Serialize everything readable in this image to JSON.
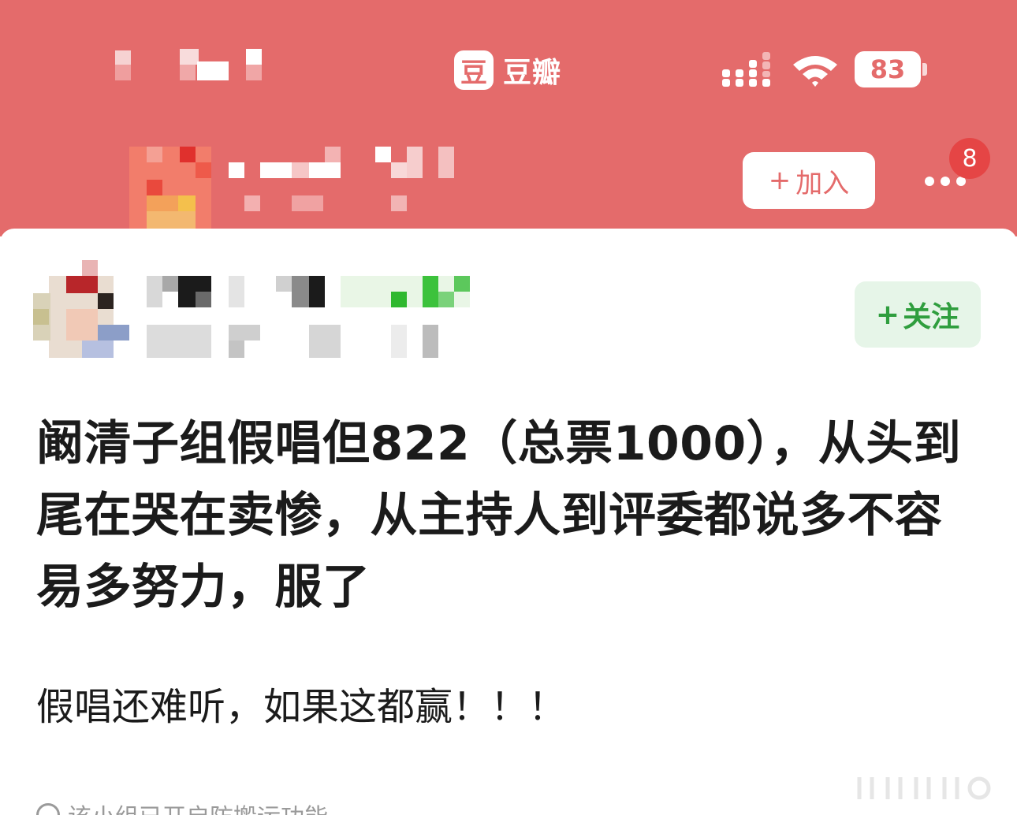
{
  "status_bar": {
    "app_logo_char": "豆",
    "app_name": "豆瓣",
    "battery": "83"
  },
  "group_bar": {
    "join_plus": "+",
    "join_label": "加入",
    "notification_count": "8"
  },
  "post": {
    "follow_plus": "+",
    "follow_label": "关注",
    "title": "阚清子组假唱但822（总票1000），从头到尾在哭在卖惨，从主持人到评委都说多不容易多努力，服了",
    "body": "假唱还难听，如果这都赢！！！",
    "footer_note": "该小组已开启防搬运功能"
  },
  "colors": {
    "header_bg": "#e46b6b",
    "follow_green": "#2f9e3e",
    "follow_bg": "#e6f5e8",
    "badge_red": "#e54545"
  },
  "icons": [
    "douban-logo-icon",
    "signal-icon",
    "wifi-icon",
    "battery-icon",
    "more-icon",
    "info-icon"
  ]
}
